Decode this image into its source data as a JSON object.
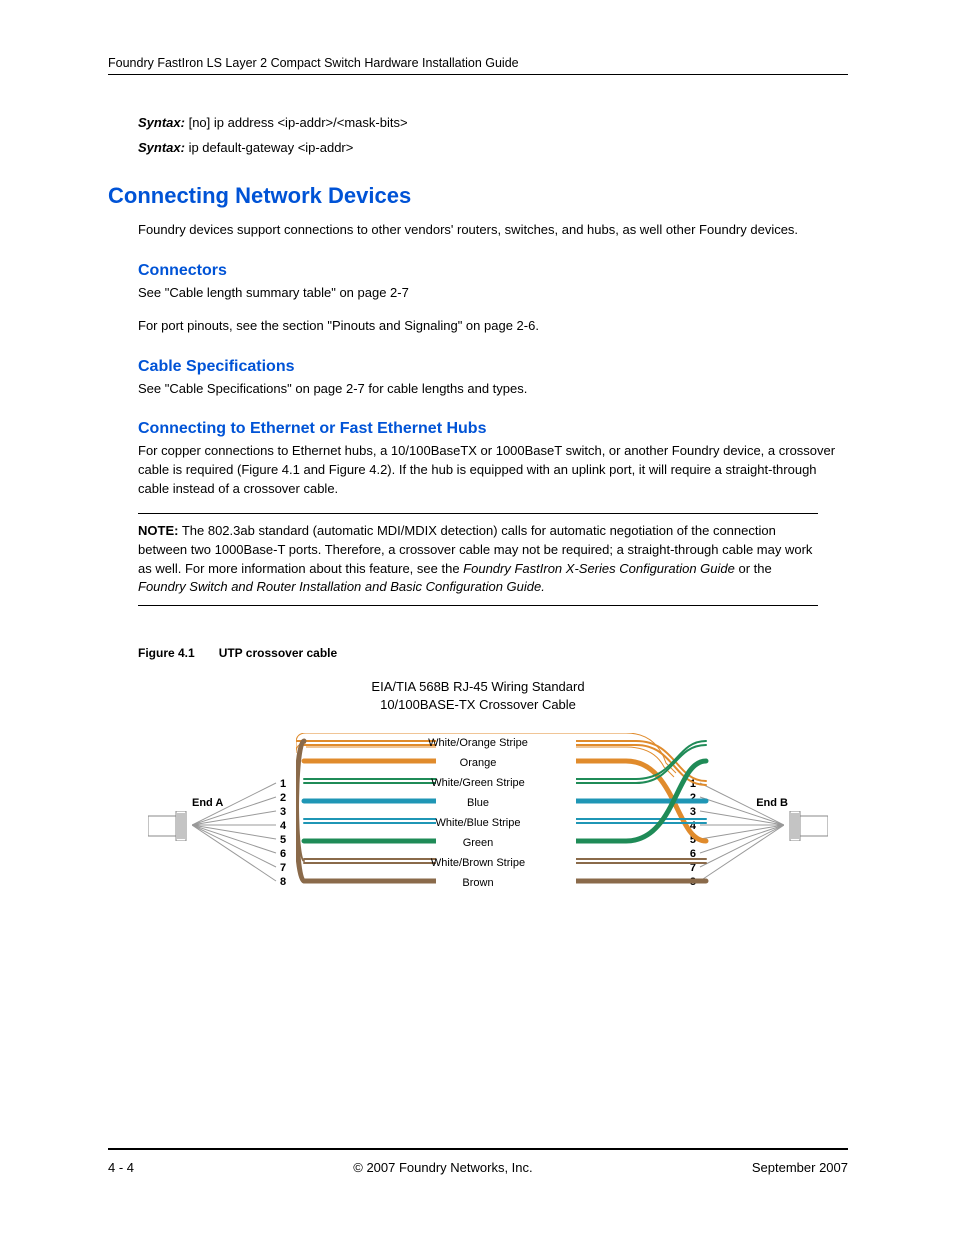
{
  "header": {
    "running": "Foundry FastIron LS Layer 2 Compact Switch Hardware Installation Guide"
  },
  "syntax": {
    "label": "Syntax:",
    "line1": " [no] ip address <ip-addr>/<mask-bits>",
    "line2": " ip default-gateway <ip-addr>"
  },
  "h_main": "Connecting Network Devices",
  "intro": "Foundry devices support connections to other vendors' routers, switches, and hubs, as well other Foundry devices.",
  "sec1": {
    "title": "Connectors",
    "p1": "See \"Cable length summary table\" on page 2-7",
    "p2": "For port pinouts, see the section \"Pinouts and Signaling\" on page 2-6."
  },
  "sec2": {
    "title": "Cable Specifications",
    "p1": "See \"Cable Specifications\" on page 2-7 for cable lengths and types."
  },
  "sec3": {
    "title": "Connecting to Ethernet or Fast Ethernet Hubs",
    "p1": "For copper connections to Ethernet hubs, a 10/100BaseTX or 1000BaseT switch, or another Foundry device, a crossover cable is required (Figure 4.1 and Figure 4.2).  If the hub is equipped with an uplink port, it will require a straight-through cable instead of a crossover cable."
  },
  "note": {
    "label": "NOTE:",
    "body_a": "   The 802.3ab standard (automatic MDI/MDIX detection) calls for automatic negotiation of the connection between two 1000Base-T ports.  Therefore, a crossover cable may not be required; a straight-through cable may work as well.  For more information about this feature, see the ",
    "ref1": "Foundry FastIron X-Series Configuration Guide",
    "body_b": " or the ",
    "ref2": "Foundry Switch and Router Installation and Basic Configuration Guide."
  },
  "figure": {
    "num": "Figure 4.1",
    "title": "UTP crossover cable",
    "dia_title1": "EIA/TIA 568B RJ-45 Wiring Standard",
    "dia_title2": "10/100BASE-TX Crossover Cable",
    "endA": "End A",
    "endB": "End B",
    "pins": [
      "1",
      "2",
      "3",
      "4",
      "5",
      "6",
      "7",
      "8"
    ],
    "wires": [
      "White/Orange Stripe",
      "Orange",
      "White/Green Stripe",
      "Blue",
      "White/Blue Stripe",
      "Green",
      "White/Brown Stripe",
      "Brown"
    ]
  },
  "footer": {
    "page": "4 - 4",
    "copy": "© 2007 Foundry Networks, Inc.",
    "date": "September 2007"
  }
}
